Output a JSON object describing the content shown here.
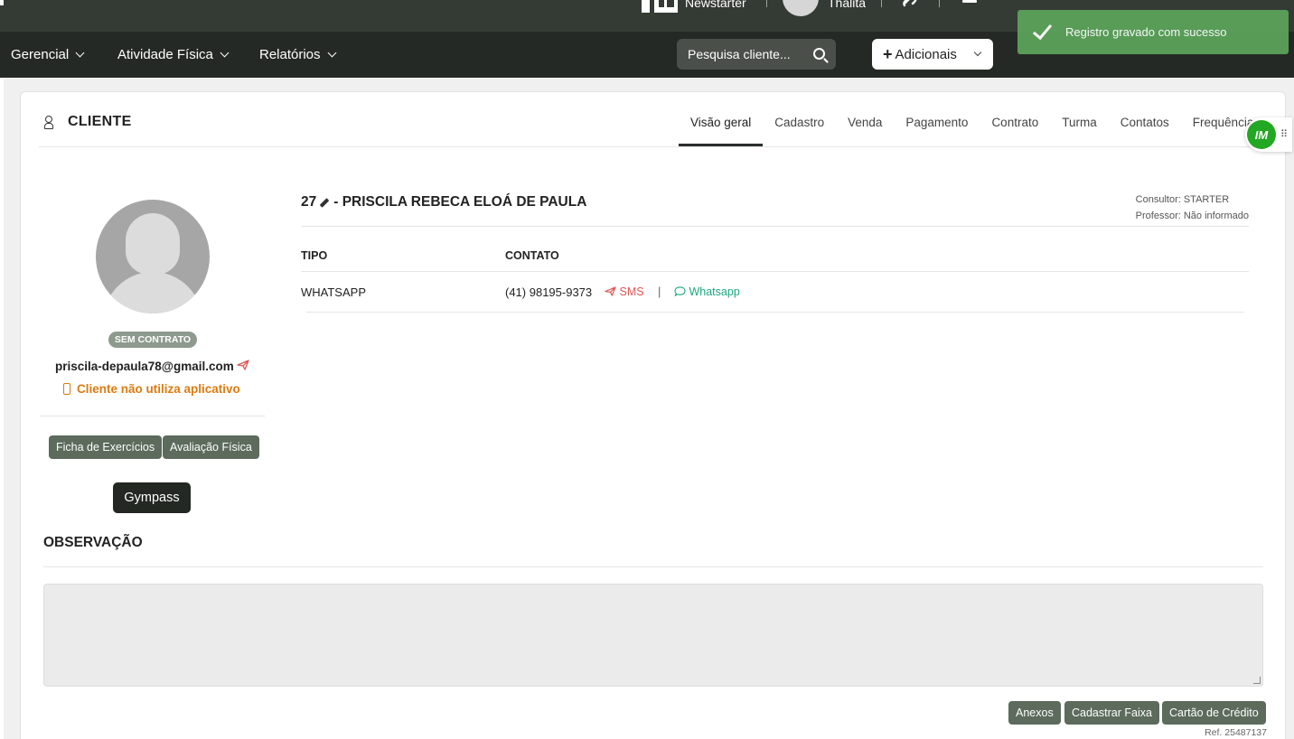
{
  "topbar": {
    "newsletter_label": "Newstarter",
    "user_name": "Thalita",
    "icons": [
      "newspaper-icon",
      "avatar",
      "link-icon",
      "bell-icon"
    ]
  },
  "nav": {
    "items": [
      {
        "label": "Gerencial"
      },
      {
        "label": "Atividade Física"
      },
      {
        "label": "Relatórios"
      }
    ],
    "search_placeholder": "Pesquisa cliente...",
    "add_label": "Adicionais"
  },
  "toast": {
    "message": "Registro gravado com sucesso",
    "color": "#5aa05a"
  },
  "page": {
    "title": "CLIENTE",
    "tabs": [
      "Visão geral",
      "Cadastro",
      "Venda",
      "Pagamento",
      "Contrato",
      "Turma",
      "Contatos",
      "Frequência"
    ],
    "active_tab": "Visão geral",
    "badge_text": "IM"
  },
  "profile": {
    "status": "SEM CONTRATO",
    "email": "priscila-depaula78@gmail.com",
    "app_status": "Cliente não utiliza aplicativo",
    "buttons": {
      "ficha": "Ficha de Exercícios",
      "avaliacao": "Avaliação Física",
      "gympass": "Gympass"
    }
  },
  "client": {
    "id": "27",
    "name": "- PRISCILA REBECA ELOÁ DE PAULA",
    "consultor": "Consultor: STARTER",
    "professor": "Professor: Não informado",
    "contacts_header": {
      "tipo": "TIPO",
      "contato": "CONTATO"
    },
    "contacts": [
      {
        "tipo": "WHATSAPP",
        "contato": "(41) 98195-9373",
        "sms": "SMS",
        "whatsapp": "Whatsapp"
      }
    ]
  },
  "observacao": {
    "title": "OBSERVAÇÃO",
    "value": ""
  },
  "footer": {
    "buttons": [
      "Anexos",
      "Cadastrar Faixa",
      "Cartão de Crédito"
    ],
    "ref": "Ref. 25487137"
  }
}
